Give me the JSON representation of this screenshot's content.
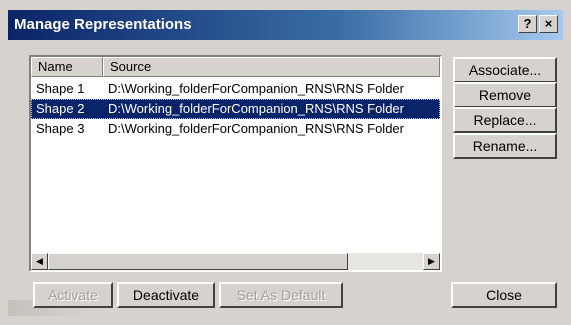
{
  "window": {
    "title": "Manage Representations",
    "help_label": "?",
    "close_label": "×"
  },
  "list": {
    "columns": [
      "Name",
      "Source"
    ],
    "rows": [
      {
        "name": "Shape 1",
        "source": "D:\\Working_folderForCompanion_RNS\\RNS Folder",
        "selected": false
      },
      {
        "name": "Shape 2",
        "source": "D:\\Working_folderForCompanion_RNS\\RNS Folder",
        "selected": true
      },
      {
        "name": "Shape 3",
        "source": "D:\\Working_folderForCompanion_RNS\\RNS Folder",
        "selected": false
      }
    ],
    "scroll_left": "◀",
    "scroll_right": "▶"
  },
  "side_buttons": {
    "associate": "Associate...",
    "remove": "Remove",
    "replace": "Replace...",
    "rename": "Rename..."
  },
  "bottom_buttons": {
    "activate": "Activate",
    "deactivate": "Deactivate",
    "set_default": "Set As Default",
    "close": "Close"
  }
}
